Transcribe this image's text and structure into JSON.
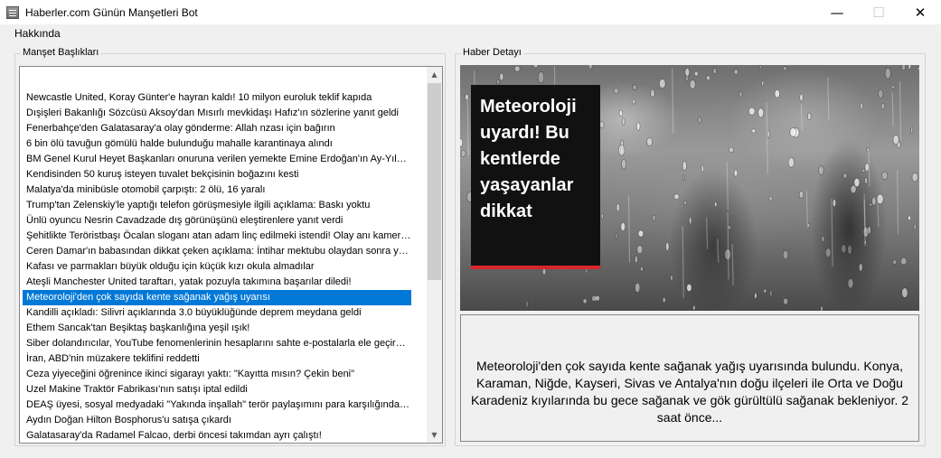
{
  "window": {
    "title": "Haberler.com Günün Manşetleri Bot",
    "minimize": "—",
    "maximize": "☐",
    "close": "✕"
  },
  "menu": {
    "items": [
      "Hakkında"
    ]
  },
  "headlines_group": {
    "label": "Manşet Başlıkları",
    "items": [
      "Newcastle United, Koray Günter'e hayran kaldı! 10 milyon euroluk teklif kapıda",
      "Dışişleri Bakanlığı Sözcüsü Aksoy'dan Mısırlı mevkidaşı Hafız'ın sözlerine yanıt geldi",
      "Fenerbahçe'den Galatasaray'a olay gönderme: Allah nzası için bağırın",
      "6 bin ölü tavuğun gömülü halde bulunduğu mahalle karantinaya alındı",
      "BM Genel Kurul Heyet Başkanları onuruna verilen yemekte Emine Erdoğan'ın Ay-Yıldızlı...",
      "Kendisinden 50 kuruş isteyen tuvalet bekçisinin boğazını kesti",
      "Malatya'da minibüsle otomobil çarpıştı: 2 ölü, 16 yaralı",
      "Trump'tan Zelenskiy'le yaptığı telefon görüşmesiyle ilgili açıklama: Baskı yoktu",
      "Ünlü oyuncu Nesrin Cavadzade dış görünüşünü eleştirenlere yanıt verdi",
      "Şehitlikte Teröristbaşı Öcalan sloganı atan adam linç edilmeki istendi! Olay anı kameray...",
      "Ceren Damar'ın babasından dikkat çeken açıklama: İntihar mektubu olaydan sonra yazı...",
      "Kafası ve parmakları büyük olduğu için küçük kızı okula almadılar",
      "Ateşli Manchester United taraftarı, yatak pozuyla takımına başarılar diledi!",
      "Meteoroloji'den çok sayıda kente sağanak yağış uyarısı",
      "Kandilli açıkladı: Silivri açıklarında 3.0 büyüklüğünde deprem meydana geldi",
      "Ethem Sancak'tan Beşiktaş başkanlığına yeşil ışık!",
      "Siber dolandırıcılar, YouTube fenomenlerinin hesaplarını sahte e-postalarla ele geçirmey...",
      "İran, ABD'nin müzakere teklifini reddetti",
      "Ceza yiyeceğini öğrenince ikinci sigarayı yaktı: \"Kayıtta mısın? Çekin beni\"",
      "Uzel Makine Traktör Fabrikası'nın satışı iptal edildi",
      "DEAŞ üyesi, sosyal medyadaki \"Yakında inşallah\" terör paylaşımını para karşılığında ya...",
      "Aydın Doğan Hilton Bosphorus'u satışa çıkardı",
      "Galatasaray'da Radamel Falcao, derbi öncesi takımdan ayrı çalıştı!"
    ],
    "selected_index": 13,
    "scroll_up": "▲",
    "scroll_down": "▼"
  },
  "detail_group": {
    "label": "Haber Detayı",
    "image_headline": "Meteoroloji uyardı! Bu kentlerde yaşayanlar dikkat",
    "description": "Meteoroloji'den çok sayıda kente sağanak yağış uyarısında bulundu. Konya, Karaman, Niğde, Kayseri, Sivas ve Antalya'nın doğu ilçeleri ile Orta ve Doğu Karadeniz kıyılarında bu gece sağanak ve gök gürültülü sağanak bekleniyor. 2 saat önce..."
  },
  "colors": {
    "selection": "#0078d7",
    "headline_box": "#111111",
    "headline_accent": "#d9262c"
  }
}
